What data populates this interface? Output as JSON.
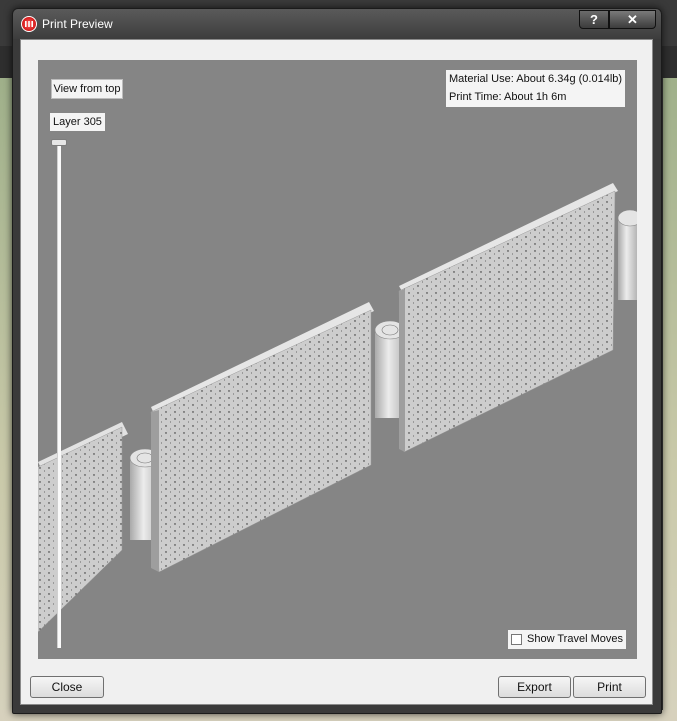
{
  "window": {
    "title": "Print Preview",
    "help_label": "?",
    "close_label": "✕"
  },
  "icons": {
    "app": "makerbot-logo-icon"
  },
  "viewer": {
    "view_from_top_label": "View from top",
    "layer_label": "Layer 305",
    "layer_slider_fraction": 1.0,
    "material_use": "Material Use: About 6.34g (0.014lb)",
    "print_time": "Print Time: About 1h 6m",
    "show_travel_moves_label": "Show Travel Moves",
    "show_travel_moves_checked": false
  },
  "buttons": {
    "close": "Close",
    "export": "Export",
    "print": "Print"
  },
  "colors": {
    "viewport_bg": "#858585",
    "model": "#cfcfcf",
    "accent": "#d01010"
  }
}
